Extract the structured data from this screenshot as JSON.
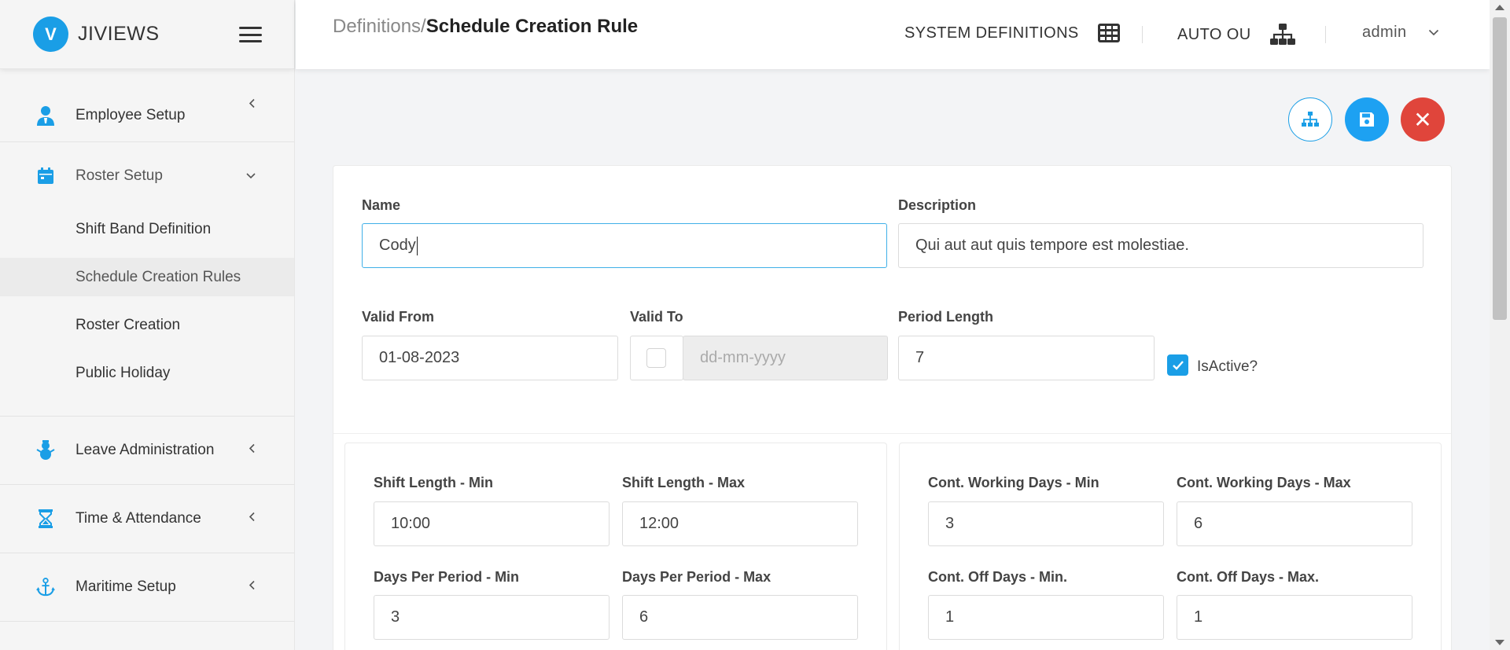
{
  "brand": {
    "name": "JIVIEWS",
    "logo_letter": "V"
  },
  "sidebar": {
    "items": [
      {
        "label": "Employee Setup",
        "icon": "user-tie-icon",
        "chevron": "‹"
      },
      {
        "label": "Roster Setup",
        "icon": "calendar-icon",
        "chevron": "⌄"
      },
      {
        "label": "Leave Administration",
        "icon": "snowman-icon",
        "chevron": "‹"
      },
      {
        "label": "Time & Attendance",
        "icon": "hourglass-icon",
        "chevron": "‹"
      },
      {
        "label": "Maritime Setup",
        "icon": "anchor-icon",
        "chevron": "‹"
      }
    ],
    "roster_sub": [
      "Shift Band Definition",
      "Schedule Creation Rules",
      "Roster Creation",
      "Public Holiday"
    ]
  },
  "header": {
    "breadcrumb_parent": "Definitions/",
    "breadcrumb_current": "Schedule Creation Rule",
    "system_definitions": "SYSTEM DEFINITIONS",
    "auto_ou": "AUTO OU",
    "user": "admin"
  },
  "form": {
    "name_label": "Name",
    "name_value": "Cody",
    "description_label": "Description",
    "description_value": "Qui aut aut quis tempore est molestiae.",
    "valid_from_label": "Valid From",
    "valid_from_value": "01-08-2023",
    "valid_to_label": "Valid To",
    "valid_to_placeholder": "dd-mm-yyyy",
    "period_length_label": "Period Length",
    "period_length_value": "7",
    "is_active_label": "IsActive?",
    "is_active": true,
    "close_symbol": "✕"
  },
  "rules": {
    "shift_min_label": "Shift Length - Min",
    "shift_min_value": "10:00",
    "shift_max_label": "Shift Length - Max",
    "shift_max_value": "12:00",
    "days_min_label": "Days Per Period - Min",
    "days_min_value": "3",
    "days_max_label": "Days Per Period - Max",
    "days_max_value": "6",
    "work_min_label": "Cont. Working Days - Min",
    "work_min_value": "3",
    "work_max_label": "Cont. Working Days - Max",
    "work_max_value": "6",
    "off_min_label": "Cont. Off Days - Min.",
    "off_min_value": "1",
    "off_max_label": "Cont. Off Days - Max.",
    "off_max_value": "1"
  },
  "colors": {
    "accent": "#1a9ee6",
    "danger": "#e0453b"
  }
}
